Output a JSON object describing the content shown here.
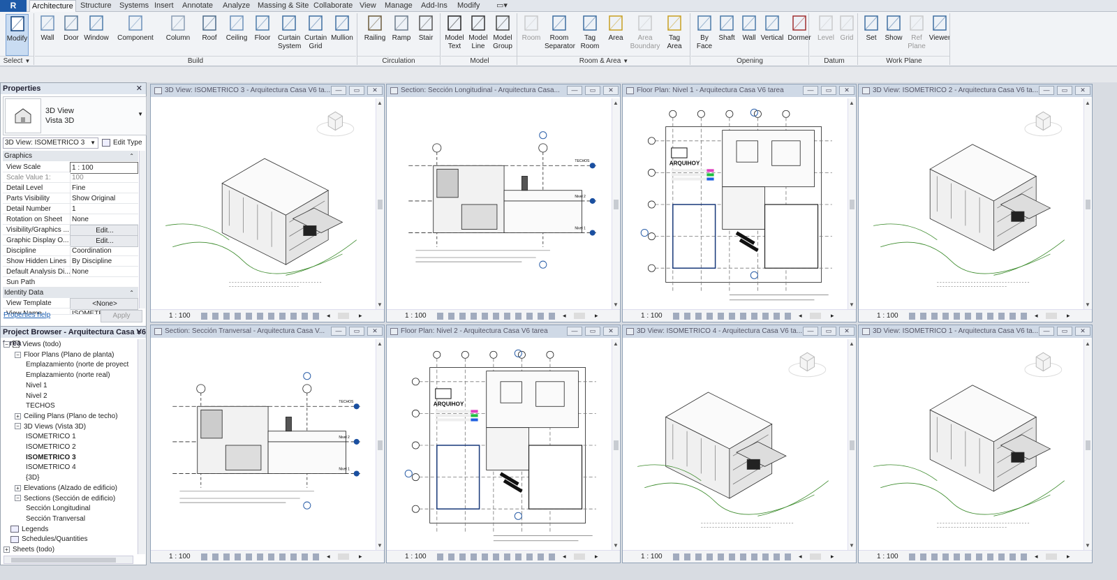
{
  "ribbon_tabs": [
    "Architecture",
    "Structure",
    "Systems",
    "Insert",
    "Annotate",
    "Analyze",
    "Massing & Site",
    "Collaborate",
    "View",
    "Manage",
    "Add-Ins",
    "Modify"
  ],
  "active_tab": "Architecture",
  "select_label": "Select",
  "buttons": [
    {
      "label": "Modify",
      "icon": "modify-cursor-icon"
    },
    {
      "label": "Wall",
      "icon": "wall-icon"
    },
    {
      "label": "Door",
      "icon": "door-icon"
    },
    {
      "label": "Window",
      "icon": "window-icon"
    },
    {
      "label": "Component",
      "icon": "component-icon"
    },
    {
      "label": "Column",
      "icon": "column-icon"
    },
    {
      "label": "Roof",
      "icon": "roof-icon"
    },
    {
      "label": "Ceiling",
      "icon": "ceiling-icon"
    },
    {
      "label": "Floor",
      "icon": "floor-icon"
    },
    {
      "label": "Curtain\nSystem",
      "icon": "curtain-system-icon"
    },
    {
      "label": "Curtain\nGrid",
      "icon": "curtain-grid-icon"
    },
    {
      "label": "Mullion",
      "icon": "mullion-icon"
    },
    {
      "label": "Railing",
      "icon": "railing-icon"
    },
    {
      "label": "Ramp",
      "icon": "ramp-icon"
    },
    {
      "label": "Stair",
      "icon": "stair-icon"
    },
    {
      "label": "Model\nText",
      "icon": "model-text-icon"
    },
    {
      "label": "Model\nLine",
      "icon": "model-line-icon"
    },
    {
      "label": "Model\nGroup",
      "icon": "model-group-icon"
    },
    {
      "label": "Room",
      "icon": "room-icon"
    },
    {
      "label": "Room\nSeparator",
      "icon": "room-separator-icon"
    },
    {
      "label": "Tag\nRoom",
      "icon": "tag-room-icon"
    },
    {
      "label": "Area",
      "icon": "area-icon"
    },
    {
      "label": "Area\nBoundary",
      "icon": "area-boundary-icon"
    },
    {
      "label": "Tag\nArea",
      "icon": "tag-area-icon"
    },
    {
      "label": "By\nFace",
      "icon": "by-face-icon"
    },
    {
      "label": "Shaft",
      "icon": "shaft-icon"
    },
    {
      "label": "Wall",
      "icon": "wall-opening-icon"
    },
    {
      "label": "Vertical",
      "icon": "vertical-icon"
    },
    {
      "label": "Dormer",
      "icon": "dormer-icon"
    },
    {
      "label": "Level",
      "icon": "level-icon"
    },
    {
      "label": "Grid",
      "icon": "grid-icon"
    },
    {
      "label": "Set",
      "icon": "set-icon"
    },
    {
      "label": "Show",
      "icon": "show-icon"
    },
    {
      "label": "Ref\nPlane",
      "icon": "ref-plane-icon"
    },
    {
      "label": "Viewer",
      "icon": "viewer-icon"
    }
  ],
  "groups": [
    "Build",
    "Circulation",
    "Model",
    "Room & Area",
    "Opening",
    "Datum",
    "Work Plane"
  ],
  "properties": {
    "title": "Properties",
    "type_line1": "3D View",
    "type_line2": "Vista 3D",
    "view_selector": "3D View: ISOMETRICO 3",
    "edit_type": "Edit Type",
    "sec_graphics": "Graphics",
    "rows": [
      {
        "k": "View Scale",
        "v": "1 : 100"
      },
      {
        "k": "Scale Value    1:",
        "v": "100"
      },
      {
        "k": "Detail Level",
        "v": "Fine"
      },
      {
        "k": "Parts Visibility",
        "v": "Show Original"
      },
      {
        "k": "Detail Number",
        "v": "1"
      },
      {
        "k": "Rotation on Sheet",
        "v": "None"
      },
      {
        "k": "Visibility/Graphics ...",
        "v": "Edit..."
      },
      {
        "k": "Graphic Display O...",
        "v": "Edit..."
      },
      {
        "k": "Discipline",
        "v": "Coordination"
      },
      {
        "k": "Show Hidden Lines",
        "v": "By Discipline"
      },
      {
        "k": "Default Analysis Di...",
        "v": "None"
      },
      {
        "k": "Sun Path",
        "v": ""
      }
    ],
    "sec_identity": "Identity Data",
    "identity_rows": [
      {
        "k": "View Template",
        "v": "<None>"
      },
      {
        "k": "View Name",
        "v": "ISOMETRICO 3"
      }
    ],
    "help": "Properties help",
    "apply": "Apply"
  },
  "browser": {
    "title": "Project Browser - Arquitectura Casa V6 tarea",
    "items": [
      {
        "label": "Views (todo)",
        "toggle": "−"
      },
      {
        "label": "Floor Plans (Plano de planta)",
        "toggle": "−"
      },
      {
        "label": "Emplazamiento (norte de proyect",
        "toggle": ""
      },
      {
        "label": "Emplazamiento (norte real)",
        "toggle": ""
      },
      {
        "label": "Nivel 1",
        "toggle": ""
      },
      {
        "label": "Nivel 2",
        "toggle": ""
      },
      {
        "label": "TECHOS",
        "toggle": ""
      },
      {
        "label": "Ceiling Plans (Plano de techo)",
        "toggle": "+"
      },
      {
        "label": "3D Views (Vista 3D)",
        "toggle": "−"
      },
      {
        "label": "ISOMETRICO 1",
        "toggle": ""
      },
      {
        "label": "ISOMETRICO 2",
        "toggle": ""
      },
      {
        "label": "ISOMETRICO 3",
        "toggle": ""
      },
      {
        "label": "ISOMETRICO 4",
        "toggle": ""
      },
      {
        "label": "{3D}",
        "toggle": ""
      },
      {
        "label": "Elevations (Alzado de edificio)",
        "toggle": "+"
      },
      {
        "label": "Sections (Sección de edificio)",
        "toggle": "−"
      },
      {
        "label": "Sección Longitudinal",
        "toggle": ""
      },
      {
        "label": "Sección Tranversal",
        "toggle": ""
      },
      {
        "label": "Legends",
        "toggle": ""
      },
      {
        "label": "Schedules/Quantities",
        "toggle": ""
      },
      {
        "label": "Sheets (todo)",
        "toggle": "+"
      }
    ]
  },
  "views": [
    {
      "title": "3D View: ISOMETRICO 3 - Arquitectura Casa V6 ta...",
      "scale": "1 : 100",
      "kind": "iso"
    },
    {
      "title": "Section: Sección Longitudinal - Arquitectura Casa...",
      "scale": "1 : 100",
      "kind": "section"
    },
    {
      "title": "Floor Plan: Nivel 1 - Arquitectura Casa V6 tarea",
      "scale": "1 : 100",
      "kind": "plan"
    },
    {
      "title": "3D View: ISOMETRICO 2 - Arquitectura Casa V6 ta...",
      "scale": "1 : 100",
      "kind": "iso"
    },
    {
      "title": "Section: Sección Tranversal - Arquitectura Casa V...",
      "scale": "1 : 100",
      "kind": "section"
    },
    {
      "title": "Floor Plan: Nivel 2 - Arquitectura Casa V6 tarea",
      "scale": "1 : 100",
      "kind": "plan"
    },
    {
      "title": "3D View: ISOMETRICO 4 - Arquitectura Casa V6 ta...",
      "scale": "1 : 100",
      "kind": "iso"
    },
    {
      "title": "3D View: ISOMETRICO 1 - Arquitectura Casa V6 ta...",
      "scale": "1 : 100",
      "kind": "iso"
    }
  ],
  "drawing_text": {
    "arquihoy": "ARQUIHOY",
    "techos": "TECHOS",
    "nivel2": "Nivel 2",
    "nivel1": "Nivel 1"
  }
}
